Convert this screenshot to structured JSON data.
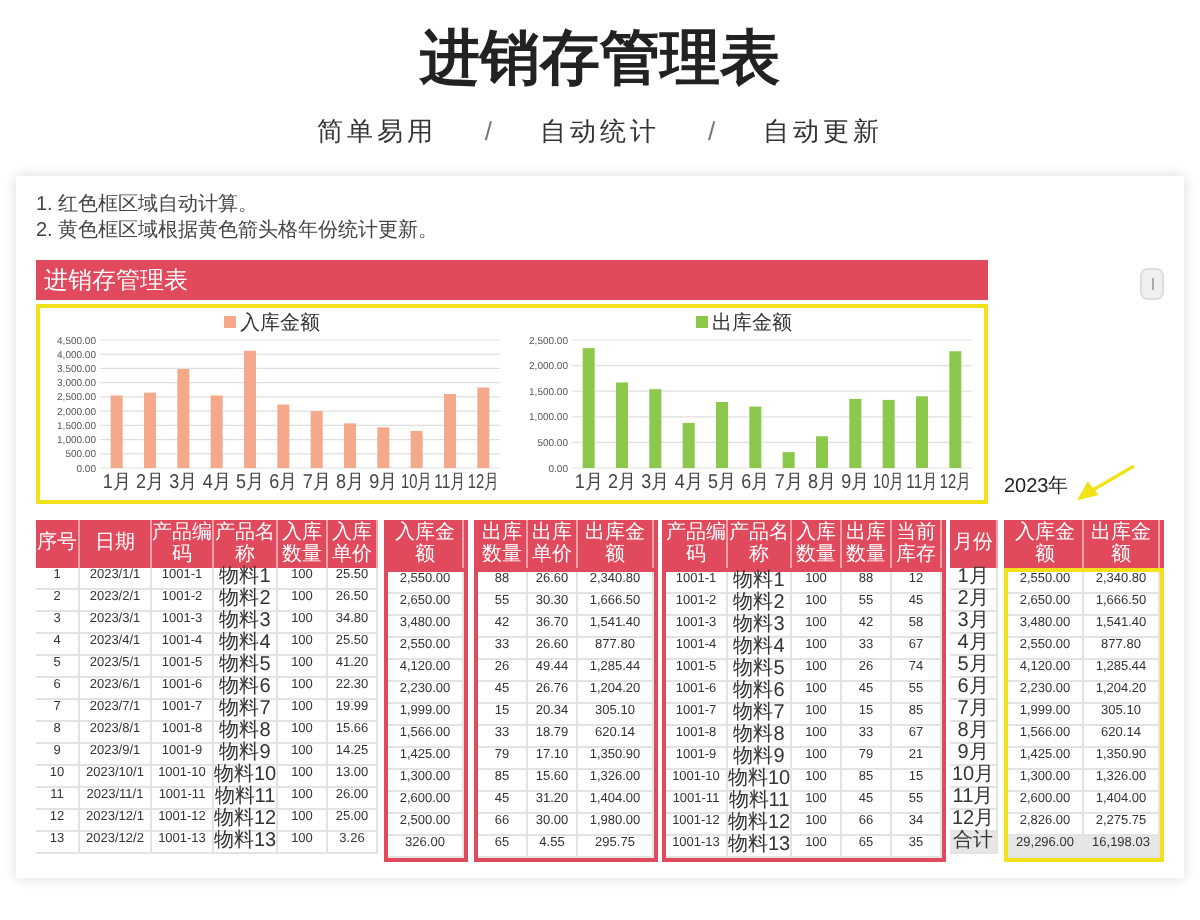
{
  "title": "进销存管理表",
  "subtitle": [
    {
      "kind": "label",
      "text": "简单易用"
    },
    {
      "kind": "separator",
      "text": "/"
    },
    {
      "kind": "label",
      "text": "自动统计"
    },
    {
      "kind": "separator",
      "text": "/"
    },
    {
      "kind": "label",
      "text": "自动更新"
    }
  ],
  "notes": [
    "1. 红色框区域自动计算。",
    "2. 黄色框区域根据黄色箭头格年份统计更新。"
  ],
  "sheet_title": "进销存管理表",
  "charts": [
    {
      "chart_data": {
        "type": "bar",
        "categories": [
          "1月",
          "2月",
          "3月",
          "4月",
          "5月",
          "6月",
          "7月",
          "8月",
          "9月",
          "10月",
          "11月",
          "12月"
        ],
        "series": [
          {
            "name": "入库金额",
            "color": "#f4a98a",
            "values": [
              2550,
              2650,
              3480,
              2550,
              4120,
              2230,
              2000,
              1570,
              1430,
              1300,
              2600,
              2830
            ]
          }
        ],
        "grid": true,
        "ylim": [
          0,
          4500
        ],
        "yticks": [
          {
            "value": 0,
            "label": "0.00"
          },
          {
            "value": 500,
            "label": "500.00"
          },
          {
            "value": 1000,
            "label": "1,000.00"
          },
          {
            "value": 1500,
            "label": "1,500.00"
          },
          {
            "value": 2000,
            "label": "2,000.00"
          },
          {
            "value": 2500,
            "label": "2,500.00"
          },
          {
            "value": 3000,
            "label": "3,000.00"
          },
          {
            "value": 3500,
            "label": "3,500.00"
          },
          {
            "value": 4000,
            "label": "4,000.00"
          },
          {
            "value": 4500,
            "label": "4,500.00"
          }
        ]
      }
    },
    {
      "chart_data": {
        "type": "bar",
        "categories": [
          "1月",
          "2月",
          "3月",
          "4月",
          "5月",
          "6月",
          "7月",
          "8月",
          "9月",
          "10月",
          "11月",
          "12月"
        ],
        "series": [
          {
            "name": "出库金额",
            "color": "#8cc84b",
            "values": [
              2340,
              1670,
              1540,
              880,
              1290,
              1200,
              310,
              620,
              1350,
              1330,
              1400,
              2280
            ]
          }
        ],
        "grid": true,
        "ylim": [
          0,
          2500
        ],
        "yticks": [
          {
            "value": 0,
            "label": "0.00"
          },
          {
            "value": 500,
            "label": "500.00"
          },
          {
            "value": 1000,
            "label": "1,000.00"
          },
          {
            "value": 1500,
            "label": "1,500.00"
          },
          {
            "value": 2000,
            "label": "2,000.00"
          },
          {
            "value": 2500,
            "label": "2,500.00"
          }
        ]
      }
    }
  ],
  "year_label": "2023年",
  "tables": [
    {
      "total_row": false,
      "blocks": [
        {
          "outlined": false,
          "columns": [
            {
              "header": "序号",
              "kind": "index"
            },
            {
              "header": "日期",
              "kind": "date"
            },
            {
              "header": "产品编码",
              "kind": "code"
            },
            {
              "header": "产品名称",
              "kind": "name"
            },
            {
              "header": "入库数量",
              "kind": "qty"
            },
            {
              "header": "入库单价",
              "kind": "qty"
            }
          ],
          "rows": [
            [
              "1",
              "2023/1/1",
              "1001-1",
              "物料1",
              "100",
              "25.50"
            ],
            [
              "2",
              "2023/2/1",
              "1001-2",
              "物料2",
              "100",
              "26.50"
            ],
            [
              "3",
              "2023/3/1",
              "1001-3",
              "物料3",
              "100",
              "34.80"
            ],
            [
              "4",
              "2023/4/1",
              "1001-4",
              "物料4",
              "100",
              "25.50"
            ],
            [
              "5",
              "2023/5/1",
              "1001-5",
              "物料5",
              "100",
              "41.20"
            ],
            [
              "6",
              "2023/6/1",
              "1001-6",
              "物料6",
              "100",
              "22.30"
            ],
            [
              "7",
              "2023/7/1",
              "1001-7",
              "物料7",
              "100",
              "19.99"
            ],
            [
              "8",
              "2023/8/1",
              "1001-8",
              "物料8",
              "100",
              "15.66"
            ],
            [
              "9",
              "2023/9/1",
              "1001-9",
              "物料9",
              "100",
              "14.25"
            ],
            [
              "10",
              "2023/10/1",
              "1001-10",
              "物料10",
              "100",
              "13.00"
            ],
            [
              "11",
              "2023/11/1",
              "1001-11",
              "物料11",
              "100",
              "26.00"
            ],
            [
              "12",
              "2023/12/1",
              "1001-12",
              "物料12",
              "100",
              "25.00"
            ],
            [
              "13",
              "2023/12/2",
              "1001-13",
              "物料13",
              "100",
              "3.26"
            ]
          ]
        },
        {
          "outlined": true,
          "color": "#e04a5c",
          "columns": [
            {
              "header": "入库金额",
              "kind": "amount"
            }
          ],
          "rows": [
            [
              "2,550.00"
            ],
            [
              "2,650.00"
            ],
            [
              "3,480.00"
            ],
            [
              "2,550.00"
            ],
            [
              "4,120.00"
            ],
            [
              "2,230.00"
            ],
            [
              "1,999.00"
            ],
            [
              "1,566.00"
            ],
            [
              "1,425.00"
            ],
            [
              "1,300.00"
            ],
            [
              "2,600.00"
            ],
            [
              "2,500.00"
            ],
            [
              "326.00"
            ]
          ]
        },
        {
          "outlined": true,
          "color": "#e04a5c",
          "columns": [
            {
              "header": "出库数量",
              "kind": "qty"
            },
            {
              "header": "出库单价",
              "kind": "qty"
            },
            {
              "header": "出库金额",
              "kind": "amount"
            }
          ],
          "rows": [
            [
              "88",
              "26.60",
              "2,340.80"
            ],
            [
              "55",
              "30.30",
              "1,666.50"
            ],
            [
              "42",
              "36.70",
              "1,541.40"
            ],
            [
              "33",
              "26.60",
              "877.80"
            ],
            [
              "26",
              "49.44",
              "1,285.44"
            ],
            [
              "45",
              "26.76",
              "1,204.20"
            ],
            [
              "15",
              "20.34",
              "305.10"
            ],
            [
              "33",
              "18.79",
              "620.14"
            ],
            [
              "79",
              "17.10",
              "1,350.90"
            ],
            [
              "85",
              "15.60",
              "1,326.00"
            ],
            [
              "45",
              "31.20",
              "1,404.00"
            ],
            [
              "66",
              "30.00",
              "1,980.00"
            ],
            [
              "65",
              "4.55",
              "295.75"
            ]
          ]
        }
      ]
    },
    {
      "total_row": false,
      "blocks": [
        {
          "outlined": true,
          "color": "#e04a5c",
          "columns": [
            {
              "header": "产品编码",
              "kind": "code"
            },
            {
              "header": "产品名称",
              "kind": "name"
            },
            {
              "header": "入库数量",
              "kind": "qty"
            },
            {
              "header": "出库数量",
              "kind": "qty"
            },
            {
              "header": "当前库存",
              "kind": "qty"
            }
          ],
          "rows": [
            [
              "1001-1",
              "物料1",
              "100",
              "88",
              "12"
            ],
            [
              "1001-2",
              "物料2",
              "100",
              "55",
              "45"
            ],
            [
              "1001-3",
              "物料3",
              "100",
              "42",
              "58"
            ],
            [
              "1001-4",
              "物料4",
              "100",
              "33",
              "67"
            ],
            [
              "1001-5",
              "物料5",
              "100",
              "26",
              "74"
            ],
            [
              "1001-6",
              "物料6",
              "100",
              "45",
              "55"
            ],
            [
              "1001-7",
              "物料7",
              "100",
              "15",
              "85"
            ],
            [
              "1001-8",
              "物料8",
              "100",
              "33",
              "67"
            ],
            [
              "1001-9",
              "物料9",
              "100",
              "79",
              "21"
            ],
            [
              "1001-10",
              "物料10",
              "100",
              "85",
              "15"
            ],
            [
              "1001-11",
              "物料11",
              "100",
              "45",
              "55"
            ],
            [
              "1001-12",
              "物料12",
              "100",
              "66",
              "34"
            ],
            [
              "1001-13",
              "物料13",
              "100",
              "65",
              "35"
            ]
          ]
        }
      ]
    },
    {
      "total_row": true,
      "blocks": [
        {
          "outlined": false,
          "columns": [
            {
              "header": "月份",
              "kind": "month"
            }
          ],
          "rows": [
            [
              "1月"
            ],
            [
              "2月"
            ],
            [
              "3月"
            ],
            [
              "4月"
            ],
            [
              "5月"
            ],
            [
              "6月"
            ],
            [
              "7月"
            ],
            [
              "8月"
            ],
            [
              "9月"
            ],
            [
              "10月"
            ],
            [
              "11月"
            ],
            [
              "12月"
            ],
            [
              "合计"
            ]
          ]
        },
        {
          "outlined": true,
          "color": "#f2e21c",
          "columns": [
            {
              "header": "入库金额",
              "kind": "amount"
            },
            {
              "header": "出库金额",
              "kind": "amount"
            }
          ],
          "rows": [
            [
              "2,550.00",
              "2,340.80"
            ],
            [
              "2,650.00",
              "1,666.50"
            ],
            [
              "3,480.00",
              "1,541.40"
            ],
            [
              "2,550.00",
              "877.80"
            ],
            [
              "4,120.00",
              "1,285.44"
            ],
            [
              "2,230.00",
              "1,204.20"
            ],
            [
              "1,999.00",
              "305.10"
            ],
            [
              "1,566.00",
              "620.14"
            ],
            [
              "1,425.00",
              "1,350.90"
            ],
            [
              "1,300.00",
              "1,326.00"
            ],
            [
              "2,600.00",
              "1,404.00"
            ],
            [
              "2,826.00",
              "2,275.75"
            ],
            [
              "29,296.00",
              "16,198.03"
            ]
          ]
        }
      ]
    }
  ]
}
